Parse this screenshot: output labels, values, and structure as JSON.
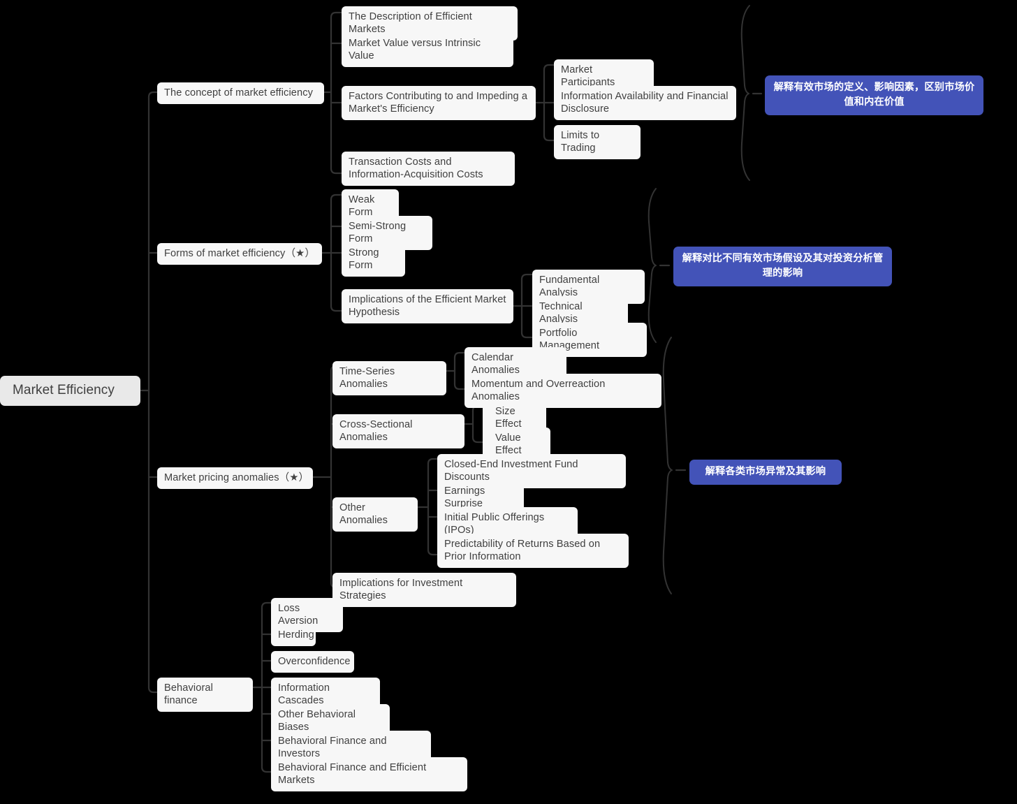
{
  "diagram": {
    "type": "mindmap",
    "title": "Market Efficiency",
    "background_color": "#000000",
    "node_color": "#f7f7f7",
    "root_color": "#e9e9e9",
    "text_color": "#3f3f3f",
    "summary_color": "#4353b8",
    "summary_text_color": "#ffffff",
    "edge_color": "#333333"
  },
  "root": {
    "label": "Market Efficiency"
  },
  "branches": [
    {
      "id": "concept",
      "label": "The concept of market efficiency",
      "children": [
        {
          "label": "The Description of Efficient Markets"
        },
        {
          "label": "Market Value versus Intrinsic Value"
        },
        {
          "label": "Factors Contributing to and Impeding a Market's Efficiency",
          "children": [
            {
              "label": "Market Participants"
            },
            {
              "label": "Information Availability and Financial Disclosure"
            },
            {
              "label": "Limits to Trading"
            }
          ]
        },
        {
          "label": "Transaction Costs and Information-Acquisition Costs"
        }
      ],
      "summary": "解释有效市场的定义、影响因素，区别市场价值和内在价值"
    },
    {
      "id": "forms",
      "label": "Forms of market efficiency（★）",
      "children": [
        {
          "label": "Weak Form"
        },
        {
          "label": "Semi-Strong Form"
        },
        {
          "label": "Strong Form"
        },
        {
          "label": "Implications of the Efficient Market Hypothesis",
          "children": [
            {
              "label": "Fundamental Analysis"
            },
            {
              "label": "Technical Analysis"
            },
            {
              "label": "Portfolio Management"
            }
          ]
        }
      ],
      "summary": "解释对比不同有效市场假设及其对投资分析管理的影响"
    },
    {
      "id": "anomalies",
      "label": "Market pricing anomalies（★）",
      "children": [
        {
          "label": "Time-Series Anomalies",
          "children": [
            {
              "label": "Calendar Anomalies"
            },
            {
              "label": "Momentum and Overreaction Anomalies"
            }
          ]
        },
        {
          "label": "Cross-Sectional Anomalies",
          "children": [
            {
              "label": "Size Effect"
            },
            {
              "label": "Value Effect"
            }
          ]
        },
        {
          "label": "Other Anomalies",
          "children": [
            {
              "label": "Closed-End Investment Fund Discounts"
            },
            {
              "label": "Earnings Surprise"
            },
            {
              "label": "Initial Public Offerings (IPOs)"
            },
            {
              "label": "Predictability of Returns Based on Prior Information"
            }
          ]
        },
        {
          "label": "Implications for Investment Strategies"
        }
      ],
      "summary": "解释各类市场异常及其影响"
    },
    {
      "id": "behavioral",
      "label": "Behavioral finance",
      "children": [
        {
          "label": "Loss Aversion"
        },
        {
          "label": "Herding"
        },
        {
          "label": "Overconfidence"
        },
        {
          "label": "Information Cascades"
        },
        {
          "label": "Other Behavioral Biases"
        },
        {
          "label": "Behavioral Finance and Investors"
        },
        {
          "label": "Behavioral Finance and Efficient Markets"
        }
      ],
      "summary": "解释各类市场异常及其影响"
    }
  ],
  "nodes": {
    "root": "Market Efficiency",
    "b1": "The concept of market efficiency",
    "b1c1": "The Description of Efficient Markets",
    "b1c2": "Market Value versus Intrinsic Value",
    "b1c3": "Factors Contributing to and Impeding a Market's Efficiency",
    "b1c3g1": "Market Participants",
    "b1c3g2": "Information Availability and Financial Disclosure",
    "b1c3g3": "Limits to Trading",
    "b1c4": "Transaction Costs and Information-Acquisition Costs",
    "b2": "Forms of market efficiency（★）",
    "b2c1": "Weak Form",
    "b2c2": "Semi-Strong Form",
    "b2c3": "Strong Form",
    "b2c4": "Implications of the Efficient Market Hypothesis",
    "b2c4g1": "Fundamental Analysis",
    "b2c4g2": "Technical Analysis",
    "b2c4g3": "Portfolio Management",
    "b3": "Market pricing anomalies（★）",
    "b3c1": "Time-Series Anomalies",
    "b3c1g1": "Calendar Anomalies",
    "b3c1g2": "Momentum and Overreaction Anomalies",
    "b3c2": "Cross-Sectional Anomalies",
    "b3c2g1": "Size Effect",
    "b3c2g2": "Value Effect",
    "b3c3": "Other Anomalies",
    "b3c3g1": "Closed-End Investment Fund Discounts",
    "b3c3g2": "Earnings Surprise",
    "b3c3g3": "Initial Public Offerings (IPOs)",
    "b3c3g4": "Predictability of Returns Based on Prior Information",
    "b3c4": "Implications for Investment Strategies",
    "b4": "Behavioral finance",
    "b4c1": "Loss Aversion",
    "b4c2": "Herding",
    "b4c3": "Overconfidence",
    "b4c4": "Information Cascades",
    "b4c5": "Other Behavioral Biases",
    "b4c6": "Behavioral Finance and Investors",
    "b4c7": "Behavioral Finance and Efficient Markets",
    "s1": "解释有效市场的定义、影响因素，区别市场价值和内在价值",
    "s2": "解释对比不同有效市场假设及其对投资分析管理的影响",
    "s3": "解释各类市场异常及其影响"
  }
}
